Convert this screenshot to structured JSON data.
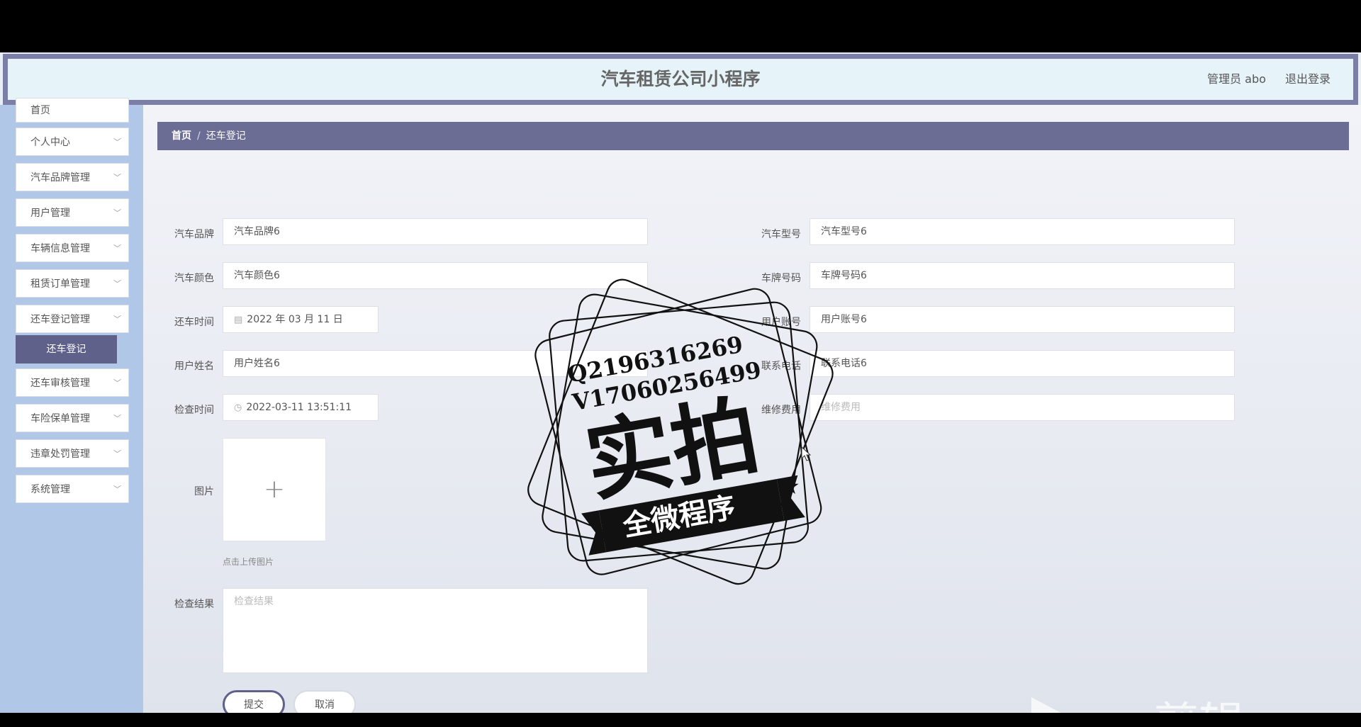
{
  "header": {
    "title": "汽车租赁公司小程序",
    "user": "管理员 abo",
    "logout": "退出登录"
  },
  "sidebar": {
    "items": [
      {
        "label": "首页"
      },
      {
        "label": "个人中心"
      },
      {
        "label": "汽车品牌管理"
      },
      {
        "label": "用户管理"
      },
      {
        "label": "车辆信息管理"
      },
      {
        "label": "租赁订单管理"
      },
      {
        "label": "还车登记管理"
      },
      {
        "label": "还车审核管理"
      },
      {
        "label": "车险保单管理"
      },
      {
        "label": "违章处罚管理"
      },
      {
        "label": "系统管理"
      }
    ],
    "active_sub": "还车登记"
  },
  "breadcrumb": {
    "home": "首页",
    "sep": "/",
    "current": "还车登记"
  },
  "form": {
    "brand": {
      "label": "汽车品牌",
      "value": "汽车品牌6"
    },
    "model": {
      "label": "汽车型号",
      "value": "汽车型号6"
    },
    "color": {
      "label": "汽车颜色",
      "value": "汽车颜色6"
    },
    "plate": {
      "label": "车牌号码",
      "value": "车牌号码6"
    },
    "return_time": {
      "label": "还车时间",
      "value": "2022 年 03 月 11 日"
    },
    "account": {
      "label": "用户账号",
      "value": "用户账号6"
    },
    "name": {
      "label": "用户姓名",
      "value": "用户姓名6"
    },
    "phone": {
      "label": "联系电话",
      "value": "联系电话6"
    },
    "check_time": {
      "label": "检查时间",
      "value": "2022-03-11 13:51:11"
    },
    "fee": {
      "label": "维修费用",
      "placeholder": "维修费用"
    },
    "image": {
      "label": "图片",
      "plus": "+",
      "tip": "点击上传图片"
    },
    "result": {
      "label": "检查结果",
      "placeholder": "检查结果"
    },
    "submit": "提交",
    "cancel": "取消"
  },
  "stamp": {
    "line1": "Q2196316269",
    "line2": "V17060256499",
    "big": "实拍",
    "banner": "全微程序"
  },
  "watermark": {
    "text": "ev剪辑"
  },
  "colors": {
    "primary": "#5f618a",
    "breadcrumb_bg": "#6c6d94",
    "sidebar_bg": "#b0c7e7",
    "header_bg": "#e6f3f9"
  }
}
